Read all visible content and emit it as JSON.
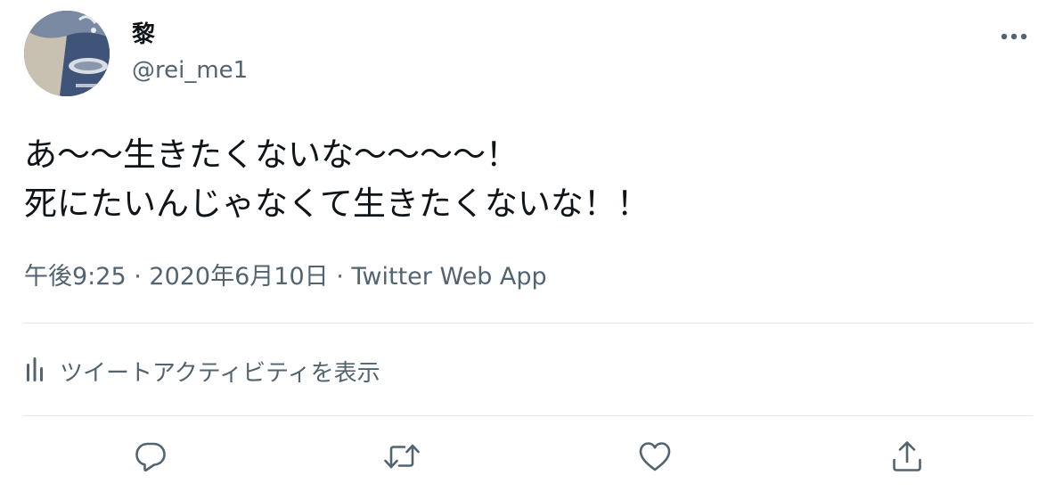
{
  "tweet": {
    "display_name": "黎",
    "handle": "@rei_me1",
    "lines": [
      "あ〜〜生きたくないな〜〜〜〜！",
      "死にたいんじゃなくて生きたくないな！！"
    ],
    "time": "午後9:25",
    "date": "2020年6月10日",
    "separator": " · ",
    "source": "Twitter Web App"
  },
  "activity": {
    "label": "ツイートアクティビティを表示",
    "icon": "bar-chart-icon"
  },
  "actions": {
    "reply_icon": "reply-icon",
    "retweet_icon": "retweet-icon",
    "like_icon": "heart-icon",
    "share_icon": "share-icon",
    "more_icon": "more-icon"
  },
  "colors": {
    "text_primary": "#0f1419",
    "text_secondary": "#536471",
    "divider": "#e3e6e8",
    "avatar_bg": "#4f6485"
  }
}
